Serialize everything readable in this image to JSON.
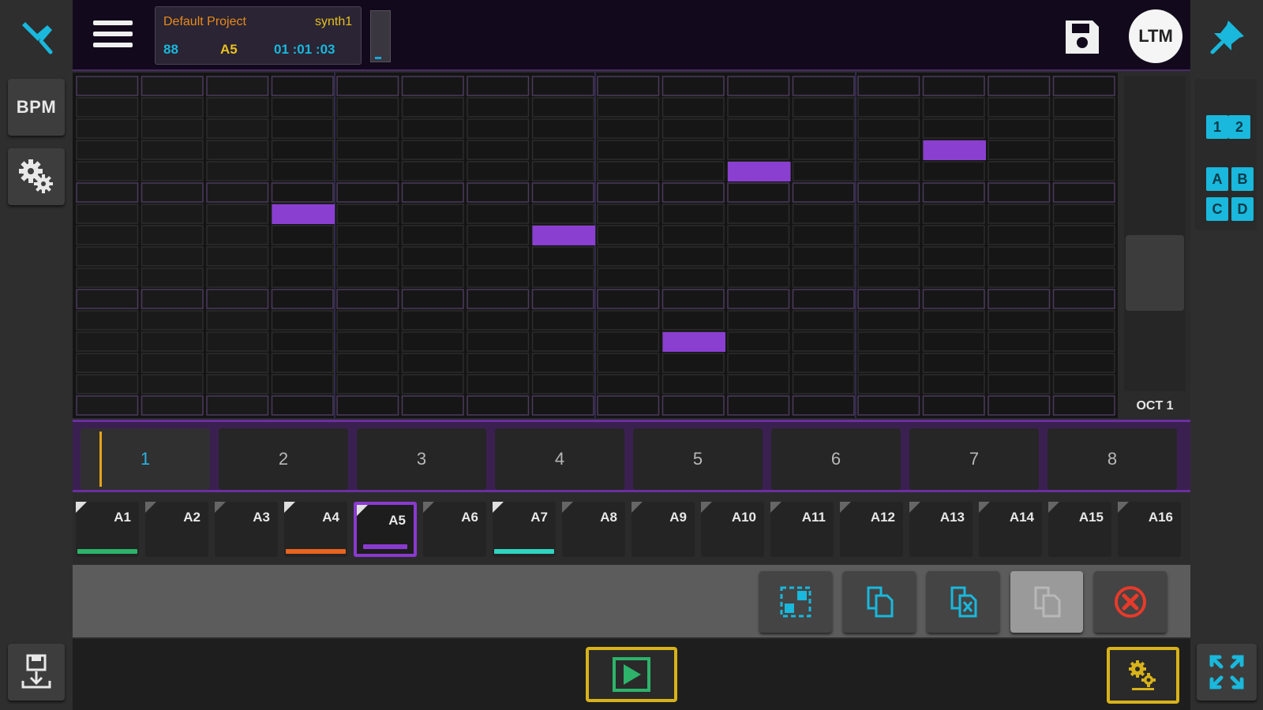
{
  "header": {
    "project_name": "Default Project",
    "instrument": "synth1",
    "tempo": "88",
    "track": "A5",
    "position": "01 :01 :03",
    "avatar_initials": "LTM"
  },
  "left_rail": {
    "bpm_label": "BPM"
  },
  "right_rail": {
    "mini_buttons": [
      "1",
      "2",
      "A",
      "B",
      "C",
      "D"
    ]
  },
  "grid": {
    "octave_label": "OCT 1",
    "note_color": "#8a3fd1",
    "notes": [
      {
        "step": 4,
        "row": 7
      },
      {
        "step": 8,
        "row": 8
      },
      {
        "step": 10,
        "row": 13
      },
      {
        "step": 11,
        "row": 5
      },
      {
        "step": 14,
        "row": 4
      }
    ]
  },
  "patterns": [
    "1",
    "2",
    "3",
    "4",
    "5",
    "6",
    "7",
    "8"
  ],
  "active_pattern": 0,
  "tracks": [
    {
      "label": "A1",
      "underline": "#2db36a",
      "corner": "bright"
    },
    {
      "label": "A2",
      "underline": "",
      "corner": "dim"
    },
    {
      "label": "A3",
      "underline": "",
      "corner": "dim"
    },
    {
      "label": "A4",
      "underline": "#e8641f",
      "corner": "bright"
    },
    {
      "label": "A5",
      "underline": "#8a3ad0",
      "corner": "bright",
      "selected": true
    },
    {
      "label": "A6",
      "underline": "",
      "corner": "dim"
    },
    {
      "label": "A7",
      "underline": "#2fd4c0",
      "corner": "bright"
    },
    {
      "label": "A8",
      "underline": "",
      "corner": "dim"
    },
    {
      "label": "A9",
      "underline": "",
      "corner": "dim"
    },
    {
      "label": "A10",
      "underline": "",
      "corner": "dim"
    },
    {
      "label": "A11",
      "underline": "",
      "corner": "dim"
    },
    {
      "label": "A12",
      "underline": "",
      "corner": "dim"
    },
    {
      "label": "A13",
      "underline": "",
      "corner": "dim"
    },
    {
      "label": "A14",
      "underline": "",
      "corner": "dim"
    },
    {
      "label": "A15",
      "underline": "",
      "corner": "dim"
    },
    {
      "label": "A16",
      "underline": "",
      "corner": "dim"
    }
  ],
  "tools": [
    {
      "name": "select-tool-button",
      "icon": "select-icon"
    },
    {
      "name": "copy-button",
      "icon": "copy-icon"
    },
    {
      "name": "cut-button",
      "icon": "cut-icon"
    },
    {
      "name": "paste-button",
      "icon": "paste-icon",
      "disabled": true
    },
    {
      "name": "delete-button",
      "icon": "delete-icon"
    }
  ],
  "colors": {
    "accent_cyan": "#19b8dc",
    "accent_purple": "#8a3fd1",
    "accent_gold": "#d8b21a",
    "project_orange": "#e88a1a",
    "instrument_yellow": "#e8c020"
  }
}
